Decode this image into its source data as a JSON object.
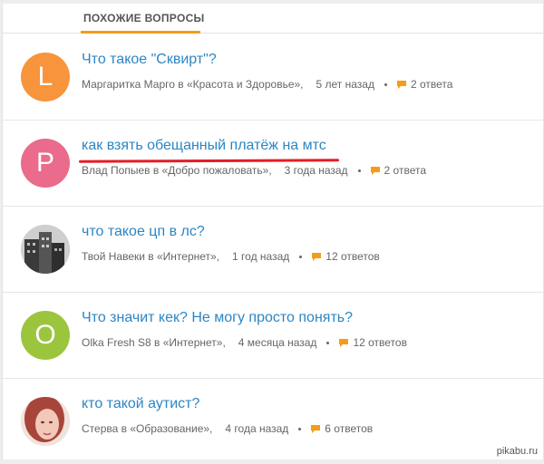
{
  "header": {
    "title": "ПОХОЖИЕ ВОПРОСЫ"
  },
  "questions": [
    {
      "avatar_letter": "L",
      "avatar_color": "#f7943c",
      "title": "Что такое \"Сквирт\"?",
      "author_in": "Маргаритка Марго в «Красота и Здоровье»,",
      "time": "5 лет назад",
      "answers": "2 ответа"
    },
    {
      "avatar_letter": "P",
      "avatar_color": "#ea6b8b",
      "title": "как взять обещанный платёж на мтс",
      "author_in": "Влад Попыев в «Добро пожаловать»,",
      "time": "3 года назад",
      "answers": "2 ответа"
    },
    {
      "avatar_letter": "",
      "avatar_color": "#6b6b6b",
      "title": "что такое цп в лс?",
      "author_in": "Твой Навеки в «Интернет»,",
      "time": "1 год назад",
      "answers": "12 ответов"
    },
    {
      "avatar_letter": "O",
      "avatar_color": "#9bc53d",
      "title": "Что значит кек? Не могу просто понять?",
      "author_in": "Olka Fresh S8 в «Интернет»,",
      "time": "4 месяца назад",
      "answers": "12 ответов"
    },
    {
      "avatar_letter": "",
      "avatar_color": "#b06a5a",
      "title": "кто такой аутист?",
      "author_in": "Стерва в «Образование»,",
      "time": "4 года назад",
      "answers": "6 ответов"
    }
  ],
  "accent_color": "#f59c1a",
  "link_color": "#2b86c5",
  "watermark": "pikabu.ru"
}
